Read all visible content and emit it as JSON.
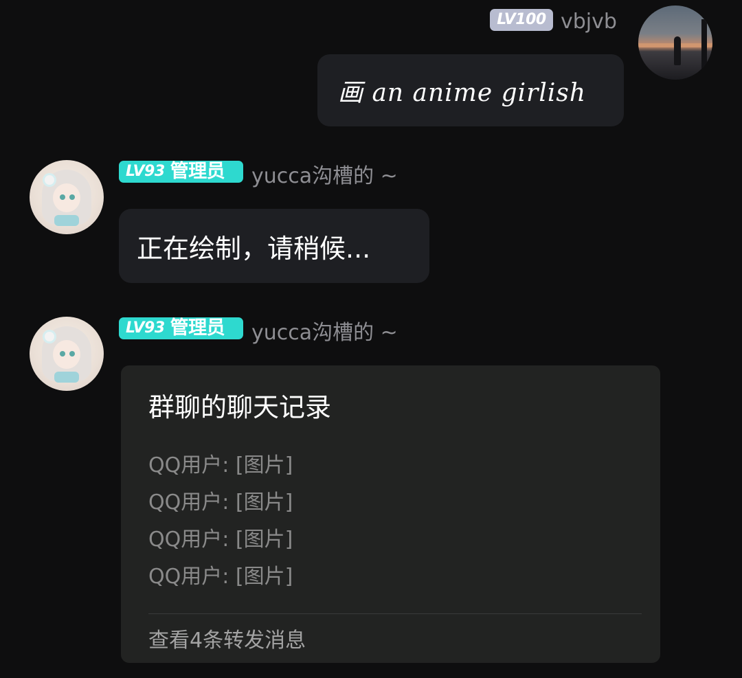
{
  "messages": [
    {
      "sender": {
        "level": "LV100",
        "nickname": "vbjvb",
        "avatar_icon": "sunset-silhouette-avatar"
      },
      "text": "画 an anime girlish"
    },
    {
      "sender": {
        "level": "LV93",
        "role": "管理员",
        "nickname": "yucca沟槽的 ~",
        "avatar_icon": "anime-girl-avatar"
      },
      "text": "正在绘制，请稍候..."
    },
    {
      "sender": {
        "level": "LV93",
        "role": "管理员",
        "nickname": "yucca沟槽的 ~",
        "avatar_icon": "anime-girl-avatar"
      },
      "forward_card": {
        "title": "群聊的聊天记录",
        "lines": [
          "QQ用户: [图片]",
          "QQ用户: [图片]",
          "QQ用户: [图片]",
          "QQ用户: [图片]"
        ],
        "footer": "查看4条转发消息"
      }
    }
  ],
  "colors": {
    "background": "#0e0e0f",
    "bubble": "#1e1f23",
    "admin_badge": "#2ed9cf",
    "user_badge": "#b8bcd0",
    "nickname": "#8e8e93"
  }
}
